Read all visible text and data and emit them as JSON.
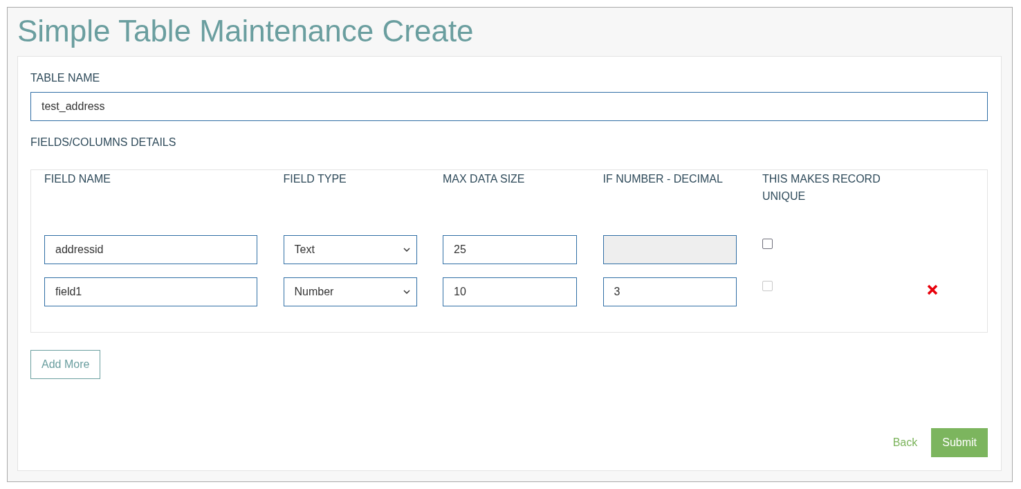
{
  "page": {
    "title": "Simple Table Maintenance Create"
  },
  "table_name": {
    "label": "TABLE NAME",
    "value": "test_address"
  },
  "fields_section": {
    "label": "FIELDS/COLUMNS DETAILS",
    "columns": [
      "FIELD NAME",
      "FIELD TYPE",
      "MAX DATA SIZE",
      "IF NUMBER - DECIMAL",
      "THIS MAKES RECORD UNIQUE"
    ],
    "rows": [
      {
        "field_name": "addressid",
        "field_type": "Text",
        "max_data_size": "25",
        "decimal": "",
        "decimal_disabled": true,
        "unique_checked": false,
        "unique_disabled": false,
        "removable": false
      },
      {
        "field_name": "field1",
        "field_type": "Number",
        "max_data_size": "10",
        "decimal": "3",
        "decimal_disabled": false,
        "unique_checked": false,
        "unique_disabled": true,
        "removable": true
      }
    ]
  },
  "add_more_button": "Add More",
  "footer": {
    "back_link": "Back",
    "submit_button": "Submit"
  }
}
